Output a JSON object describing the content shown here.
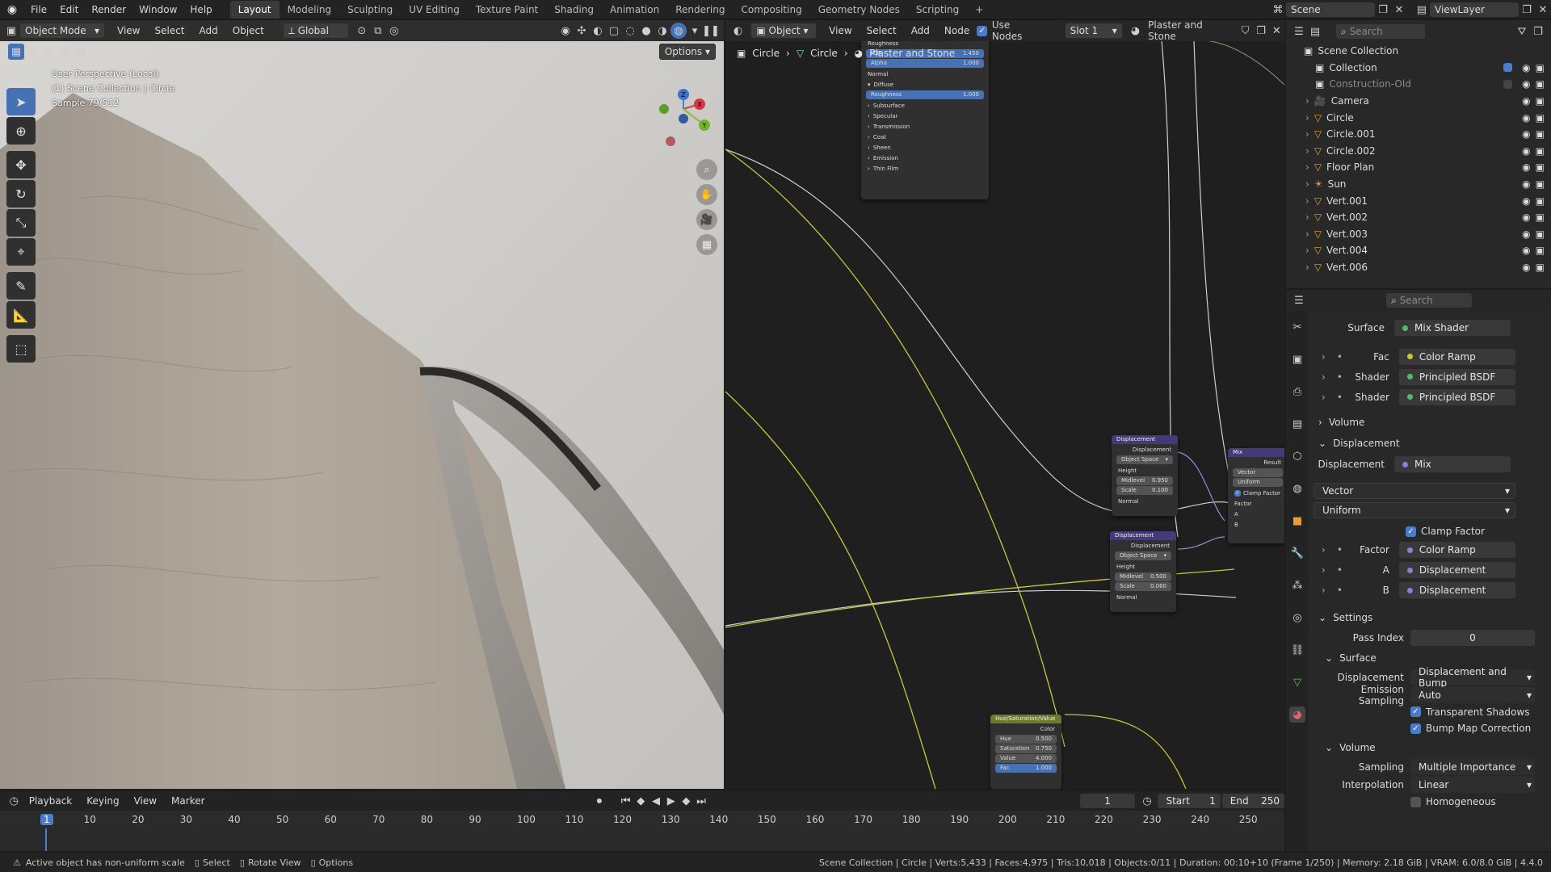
{
  "top": {
    "menu": [
      "File",
      "Edit",
      "Render",
      "Window",
      "Help"
    ],
    "workspaces": [
      "Layout",
      "Modeling",
      "Sculpting",
      "UV Editing",
      "Texture Paint",
      "Shading",
      "Animation",
      "Rendering",
      "Compositing",
      "Geometry Nodes",
      "Scripting"
    ],
    "scene": "Scene",
    "viewlayer": "ViewLayer"
  },
  "viewport": {
    "mode": "Object Mode",
    "menu": [
      "View",
      "Select",
      "Add",
      "Object"
    ],
    "transform": "Global",
    "options": "Options",
    "info": [
      "User Perspective (Local)",
      "(1) Scene Collection | Circle",
      "Sample 79/512"
    ],
    "axes": {
      "x": "X",
      "y": "Y",
      "z": "Z"
    }
  },
  "node_editor": {
    "type": "Object",
    "menu": [
      "View",
      "Select",
      "Add",
      "Node"
    ],
    "use_nodes": "Use Nodes",
    "slot": "Slot 1",
    "material": "Plaster and Stone",
    "breadcrumb": [
      "Circle",
      "Circle",
      "Plaster and Stone"
    ],
    "bsdf_rows": [
      "Roughness",
      "IOR",
      "Alpha",
      "Normal",
      "Diffuse",
      "Roughness",
      "Subsurface",
      "Specular",
      "Transmission",
      "Coat",
      "Sheen",
      "Emission",
      "Thin Film"
    ],
    "bsdf_vals": {
      "ior": "1.450",
      "alpha": "1.000",
      "roughness": "1.000"
    },
    "disp1": {
      "title": "Displacement",
      "out": "Displacement",
      "space": "Object Space",
      "height": "Height",
      "midlevel": "Midlevel",
      "midlevel_val": "0.950",
      "scale": "Scale",
      "scale_val": "0.100",
      "normal": "Normal"
    },
    "disp2": {
      "title": "Displacement",
      "out": "Displacement",
      "space": "Object Space",
      "height": "Height",
      "midlevel": "Midlevel",
      "midlevel_val": "0.500",
      "scale": "Scale",
      "scale_val": "0.060",
      "normal": "Normal"
    },
    "mix": {
      "title": "Mix",
      "result": "Result",
      "vector": "Vector",
      "uniform": "Uniform",
      "clamp": "Clamp Factor",
      "factor": "Factor",
      "a": "A",
      "b": "B"
    },
    "hsv": {
      "title": "Hue/Saturation/Value",
      "color": "Color",
      "hue": "Hue",
      "hue_val": "0.500",
      "sat": "Saturation",
      "sat_val": "0.750",
      "value": "Value",
      "value_val": "4.000",
      "fac": "Fac",
      "fac_val": "1.000"
    }
  },
  "outliner": {
    "search": "Search",
    "root": "Scene Collection",
    "items": [
      {
        "name": "Collection",
        "kind": "collection"
      },
      {
        "name": "Construction-Old",
        "kind": "collection"
      },
      {
        "name": "Camera",
        "kind": "camera"
      },
      {
        "name": "Circle",
        "kind": "mesh"
      },
      {
        "name": "Circle.001",
        "kind": "mesh"
      },
      {
        "name": "Circle.002",
        "kind": "mesh"
      },
      {
        "name": "Floor Plan",
        "kind": "mesh"
      },
      {
        "name": "Sun",
        "kind": "light"
      },
      {
        "name": "Vert.001",
        "kind": "mesh"
      },
      {
        "name": "Vert.002",
        "kind": "mesh"
      },
      {
        "name": "Vert.003",
        "kind": "mesh"
      },
      {
        "name": "Vert.004",
        "kind": "mesh"
      },
      {
        "name": "Vert.006",
        "kind": "mesh"
      }
    ]
  },
  "properties": {
    "search": "Search",
    "surface": {
      "label": "Surface",
      "value": "Mix Shader"
    },
    "surface_inputs": [
      {
        "label": "Fac",
        "value": "Color Ramp"
      },
      {
        "label": "Shader",
        "value": "Principled BSDF"
      },
      {
        "label": "Shader",
        "value": "Principled BSDF"
      }
    ],
    "volume": "Volume",
    "displacement_section": "Displacement",
    "displacement": {
      "label": "Displacement",
      "value": "Mix"
    },
    "vector": "Vector",
    "uniform": "Uniform",
    "clamp_factor": "Clamp Factor",
    "disp_inputs": [
      {
        "label": "Factor",
        "value": "Color Ramp"
      },
      {
        "label": "A",
        "value": "Displacement"
      },
      {
        "label": "B",
        "value": "Displacement"
      }
    ],
    "settings": "Settings",
    "pass_index_label": "Pass Index",
    "pass_index": "0",
    "surface_sub": "Surface",
    "disp_method_label": "Displacement",
    "disp_method": "Displacement and Bump",
    "emission_label": "Emission Sampling",
    "emission": "Auto",
    "transparent_shadows": "Transparent Shadows",
    "bump_map": "Bump Map Correction",
    "volume_sub": "Volume",
    "sampling_label": "Sampling",
    "sampling": "Multiple Importance",
    "interp_label": "Interpolation",
    "interp": "Linear",
    "homogeneous": "Homogeneous"
  },
  "timeline": {
    "menu": [
      "Playback",
      "Keying",
      "View",
      "Marker"
    ],
    "current": "1",
    "start_label": "Start",
    "start": "1",
    "end_label": "End",
    "end": "250",
    "ticks": [
      "1",
      "10",
      "20",
      "30",
      "40",
      "50",
      "60",
      "70",
      "80",
      "90",
      "100",
      "110",
      "120",
      "130",
      "140",
      "150",
      "160",
      "170",
      "180",
      "190",
      "200",
      "210",
      "220",
      "230",
      "240",
      "250"
    ]
  },
  "status": {
    "warning": "Active object has non-uniform scale",
    "select": "Select",
    "rotate": "Rotate View",
    "options": "Options",
    "stats": "Scene Collection | Circle | Verts:5,433 | Faces:4,975 | Tris:10,018 | Objects:0/11 | Duration: 00:10+10 (Frame 1/250) | Memory: 2.18 GiB | VRAM: 6.0/8.0 GiB | 4.4.0"
  }
}
